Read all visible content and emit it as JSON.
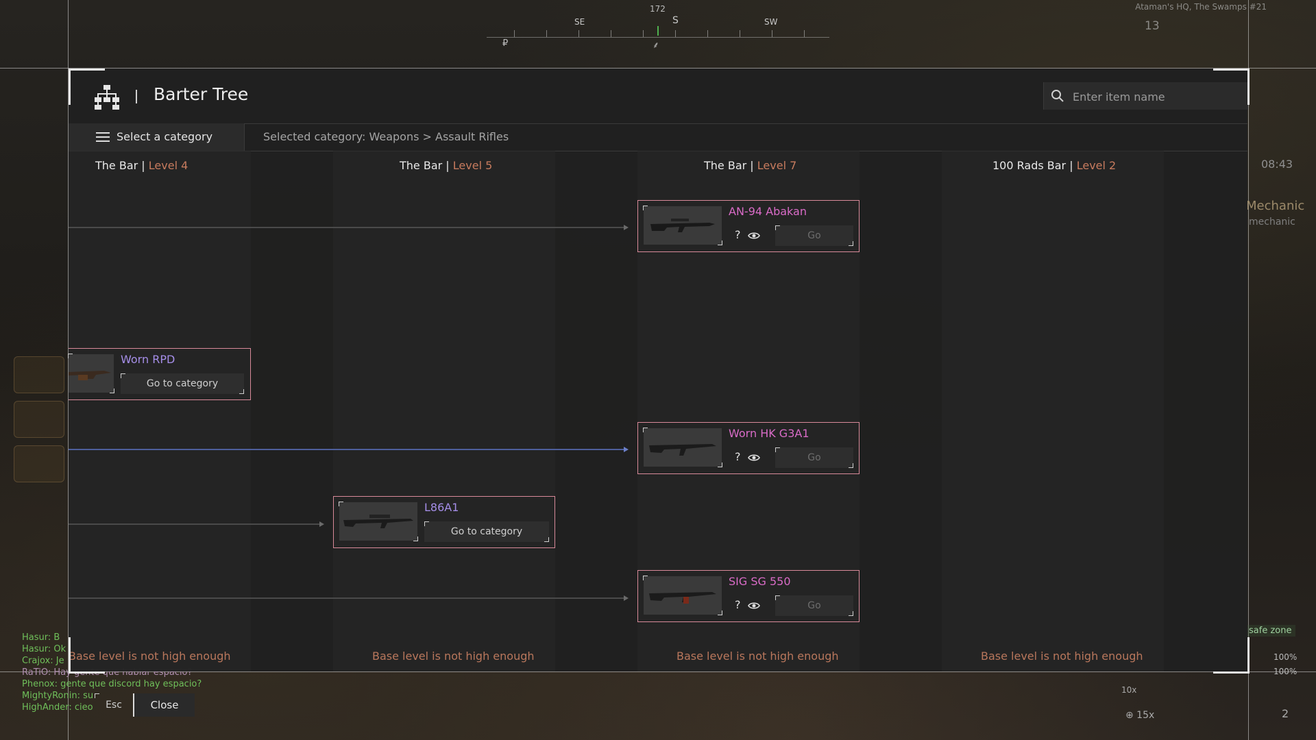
{
  "modal": {
    "title": "Barter Tree",
    "search_placeholder": "Enter item name",
    "category_button": "Select a category",
    "selected_category": "Selected category: Weapons > Assault Rifles",
    "columns": [
      {
        "trader": "The Bar",
        "separator": "|",
        "level": "Level 4",
        "footer": "Base level is not high enough"
      },
      {
        "trader": "The Bar",
        "separator": "|",
        "level": "Level 5",
        "footer": "Base level is not high enough"
      },
      {
        "trader": "The Bar",
        "separator": "|",
        "level": "Level 7",
        "footer": "Base level is not high enough"
      },
      {
        "trader": "100 Rads Bar",
        "separator": "|",
        "level": "Level 2",
        "footer": "Base level is not high enough"
      }
    ],
    "items": [
      {
        "name": "AN-94 Abakan",
        "help": "?",
        "action": "Go"
      },
      {
        "name": "Worn RPD",
        "action": "Go to category"
      },
      {
        "name": "Worn HK G3A1",
        "help": "?",
        "action": "Go"
      },
      {
        "name": "L86A1",
        "action": "Go to category"
      },
      {
        "name": "SIG SG 550",
        "help": "?",
        "action": "Go"
      }
    ],
    "esc_key": "Esc",
    "close_label": "Close"
  },
  "hud": {
    "compass": {
      "heading": "172",
      "se": "SE",
      "s": "S",
      "sw": "SW",
      "marker_ruble": "₽",
      "marker_tool": "⸙"
    },
    "location": "Ataman's HQ, The Swamps #21",
    "top_number": "13",
    "time": "08:43",
    "role_title": "Mechanic",
    "role_sub": "mechanic",
    "safe_zone": "safe zone",
    "stat_1": "100%",
    "stat_2": "100%",
    "stack_count": "⊕ 15x",
    "quick_count": "10x",
    "ammo": "2"
  },
  "chat": [
    {
      "text": "Hasur: B",
      "color": "#6fbf5a"
    },
    {
      "text": "Hasur: Ok",
      "color": "#6fbf5a"
    },
    {
      "text": "Crajox: Je",
      "color": "#6fbf5a"
    },
    {
      "text": "RaTiO: Hay gente que hablar espacio?",
      "color": "#b08fb0"
    },
    {
      "text": "Phenox: gente que discord hay espacio?",
      "color": "#6fbf5a"
    },
    {
      "text": "MightyRonin: su",
      "color": "#6fbf5a"
    },
    {
      "text": "HighAnder: cieo",
      "color": "#6fbf5a"
    }
  ],
  "colors": {
    "accent_pink": "#d96bc7",
    "accent_purple": "#a58ee8",
    "level_orange": "#c77b5e",
    "card_border": "#d98a9a",
    "link_blue": "#4e5f9c"
  }
}
